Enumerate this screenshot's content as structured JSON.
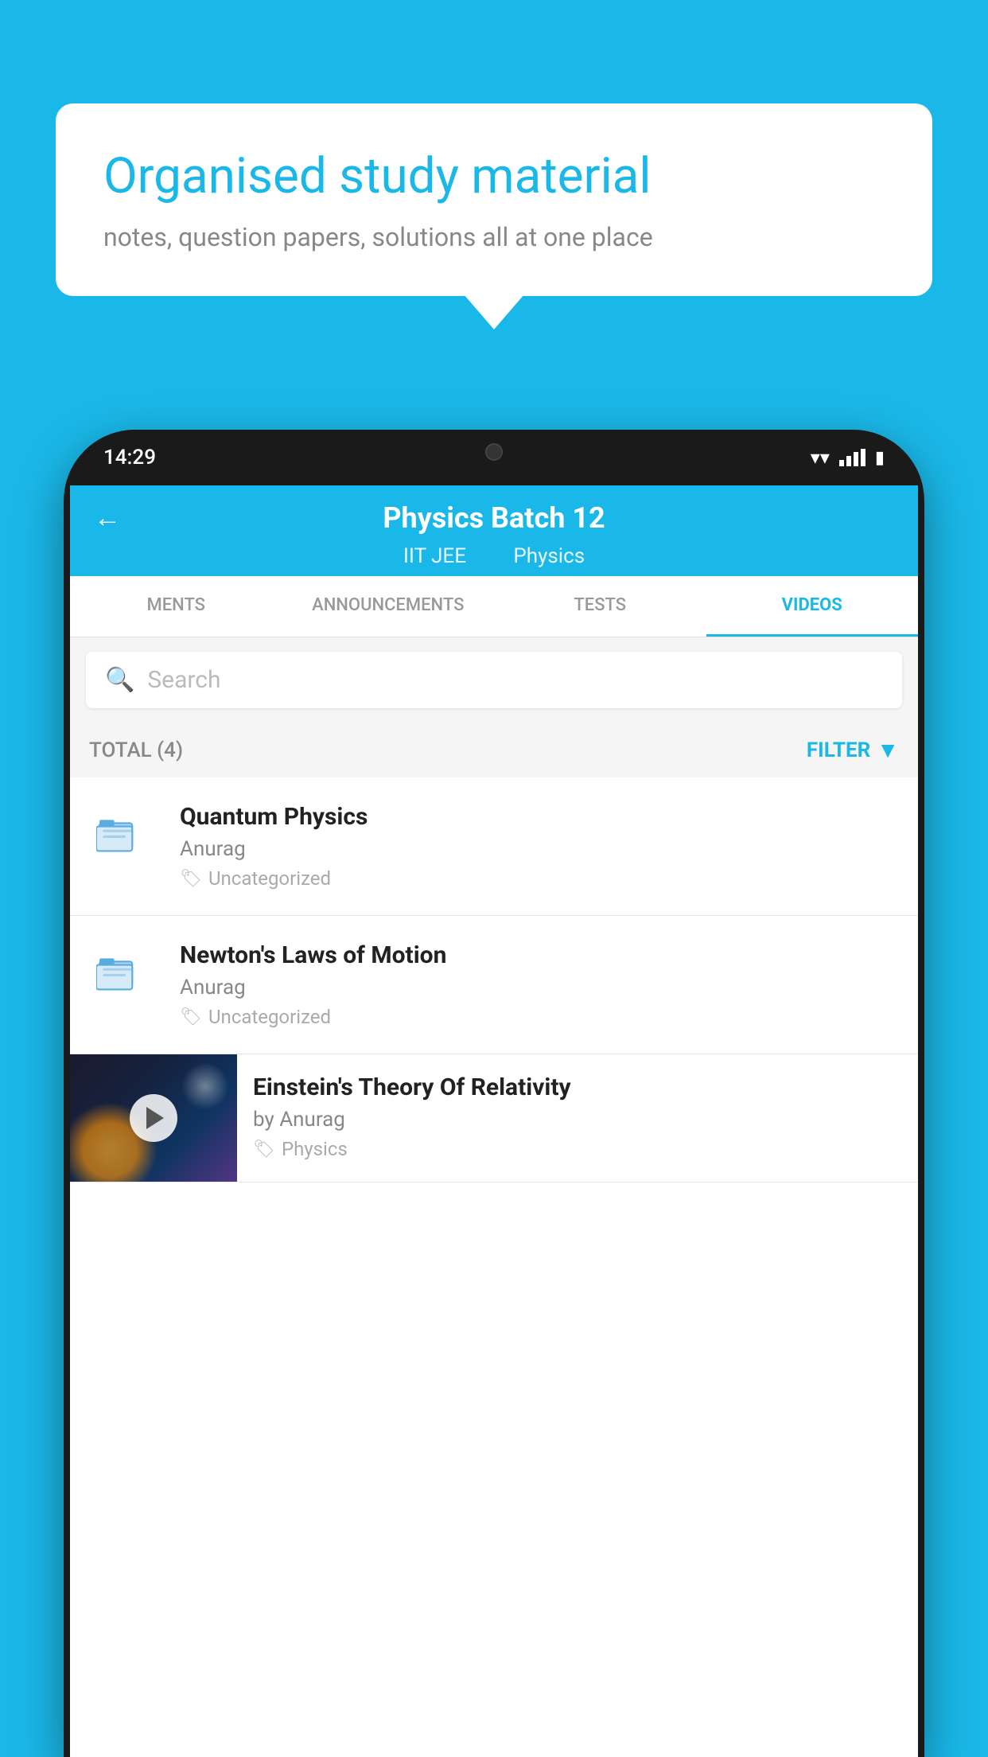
{
  "background_color": "#1ab8e8",
  "speech_bubble": {
    "title": "Organised study material",
    "subtitle": "notes, question papers, solutions all at one place"
  },
  "phone": {
    "status_bar": {
      "time": "14:29"
    },
    "header": {
      "back_label": "←",
      "title": "Physics Batch 12",
      "subtitle_part1": "IIT JEE",
      "subtitle_part2": "Physics"
    },
    "tabs": [
      {
        "label": "MENTS",
        "active": false
      },
      {
        "label": "ANNOUNCEMENTS",
        "active": false
      },
      {
        "label": "TESTS",
        "active": false
      },
      {
        "label": "VIDEOS",
        "active": true
      }
    ],
    "search": {
      "placeholder": "Search"
    },
    "filter_bar": {
      "total_label": "TOTAL (4)",
      "filter_label": "FILTER"
    },
    "videos": [
      {
        "title": "Quantum Physics",
        "author": "Anurag",
        "tag": "Uncategorized",
        "has_thumbnail": false
      },
      {
        "title": "Newton's Laws of Motion",
        "author": "Anurag",
        "tag": "Uncategorized",
        "has_thumbnail": false
      },
      {
        "title": "Einstein's Theory Of Relativity",
        "author": "by Anurag",
        "tag": "Physics",
        "has_thumbnail": true
      }
    ]
  }
}
